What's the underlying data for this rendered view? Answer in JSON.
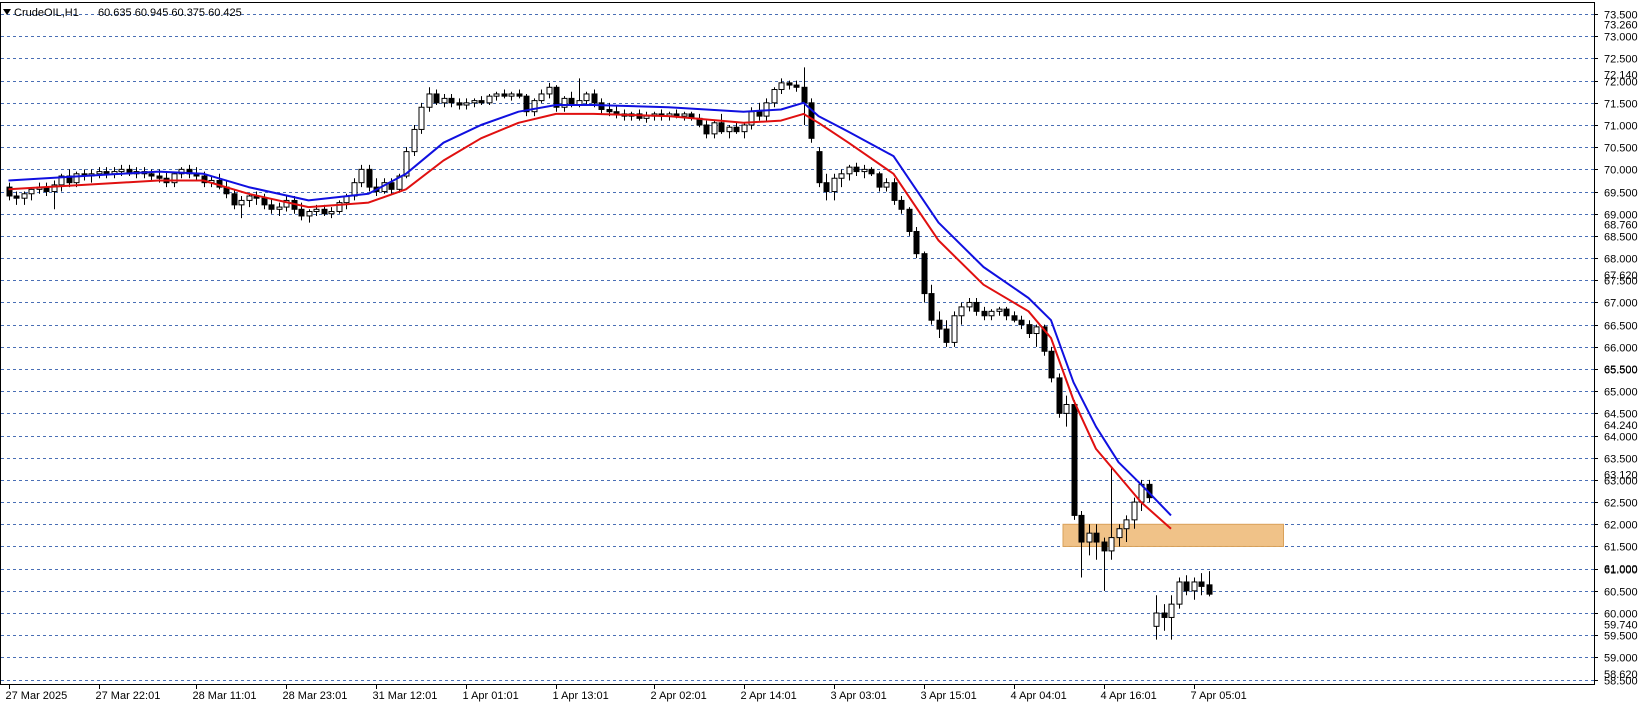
{
  "header": {
    "symbol": "CrudeOIL,H1",
    "ohlc_text": "60.635 60.945 60.375 60.425"
  },
  "colors": {
    "background": "#ffffff",
    "grid": "#4a6fb5",
    "axis": "#000000",
    "ma_fast": "#1010e0",
    "ma_slow": "#e01010",
    "zone": "#f0c288",
    "zone_border": "#d9a15a"
  },
  "chart_data": {
    "type": "candlestick",
    "y_ticks": [
      "73.500",
      "73.000",
      "72.500",
      "72.000",
      "71.500",
      "71.000",
      "70.500",
      "70.000",
      "69.500",
      "69.000",
      "68.500",
      "68.000",
      "67.500",
      "67.000",
      "66.500",
      "66.000",
      "65.500",
      "65.000",
      "64.500",
      "64.000",
      "63.500",
      "63.000",
      "62.500",
      "62.000",
      "61.500",
      "61.000",
      "60.500",
      "60.000",
      "59.500",
      "59.000",
      "58.500"
    ],
    "y_extra_labels": [
      "73.260",
      "72.140",
      "68.760",
      "67.620",
      "65.500",
      "64.240",
      "63.120",
      "61.000",
      "59.740",
      "58.620"
    ],
    "ylim": [
      58.4,
      73.75
    ],
    "x_ticks": [
      {
        "bar": 0,
        "label": "27 Mar 2025"
      },
      {
        "bar": 12,
        "label": "27 Mar 22:01"
      },
      {
        "bar": 25,
        "label": "28 Mar 11:01"
      },
      {
        "bar": 37,
        "label": "28 Mar 23:01"
      },
      {
        "bar": 49,
        "label": "31 Mar 12:01"
      },
      {
        "bar": 61,
        "label": "1 Apr 01:01"
      },
      {
        "bar": 73,
        "label": "1 Apr 13:01"
      },
      {
        "bar": 86,
        "label": "2 Apr 02:01"
      },
      {
        "bar": 98,
        "label": "2 Apr 14:01"
      },
      {
        "bar": 110,
        "label": "3 Apr 03:01"
      },
      {
        "bar": 122,
        "label": "3 Apr 15:01"
      },
      {
        "bar": 134,
        "label": "4 Apr 04:01"
      },
      {
        "bar": 146,
        "label": "4 Apr 16:01"
      },
      {
        "bar": 158,
        "label": "7 Apr 05:01"
      }
    ],
    "zone": {
      "from_bar": 141,
      "to_bar": 170,
      "low": 61.5,
      "high": 62.0
    },
    "candles": [
      [
        69.6,
        69.7,
        69.3,
        69.4
      ],
      [
        69.4,
        69.5,
        69.2,
        69.35
      ],
      [
        69.35,
        69.5,
        69.2,
        69.45
      ],
      [
        69.45,
        69.6,
        69.3,
        69.55
      ],
      [
        69.55,
        69.7,
        69.45,
        69.6
      ],
      [
        69.6,
        69.7,
        69.4,
        69.5
      ],
      [
        69.5,
        69.75,
        69.1,
        69.65
      ],
      [
        69.65,
        69.9,
        69.5,
        69.85
      ],
      [
        69.85,
        70.0,
        69.6,
        69.7
      ],
      [
        69.7,
        69.95,
        69.6,
        69.9
      ],
      [
        69.9,
        70.0,
        69.75,
        69.85
      ],
      [
        69.85,
        70.0,
        69.7,
        69.9
      ],
      [
        69.9,
        70.05,
        69.8,
        69.95
      ],
      [
        69.95,
        70.05,
        69.8,
        69.9
      ],
      [
        69.9,
        70.05,
        69.8,
        69.95
      ],
      [
        69.95,
        70.1,
        69.85,
        70.0
      ],
      [
        70.0,
        70.1,
        69.85,
        69.9
      ],
      [
        69.9,
        70.05,
        69.8,
        69.95
      ],
      [
        69.95,
        70.05,
        69.8,
        69.9
      ],
      [
        69.9,
        70.0,
        69.75,
        69.85
      ],
      [
        69.85,
        70.0,
        69.7,
        69.8
      ],
      [
        69.8,
        69.95,
        69.6,
        69.7
      ],
      [
        69.7,
        69.95,
        69.6,
        69.9
      ],
      [
        69.9,
        70.05,
        69.8,
        70.0
      ],
      [
        70.0,
        70.1,
        69.8,
        69.9
      ],
      [
        69.9,
        70.05,
        69.75,
        69.85
      ],
      [
        69.85,
        69.95,
        69.6,
        69.7
      ],
      [
        69.7,
        69.85,
        69.6,
        69.75
      ],
      [
        69.75,
        69.9,
        69.55,
        69.6
      ],
      [
        69.6,
        69.75,
        69.35,
        69.45
      ],
      [
        69.45,
        69.55,
        69.1,
        69.2
      ],
      [
        69.2,
        69.4,
        68.9,
        69.3
      ],
      [
        69.3,
        69.45,
        69.15,
        69.4
      ],
      [
        69.4,
        69.5,
        69.2,
        69.35
      ],
      [
        69.35,
        69.45,
        69.1,
        69.2
      ],
      [
        69.2,
        69.35,
        69.0,
        69.1
      ],
      [
        69.1,
        69.25,
        68.95,
        69.15
      ],
      [
        69.15,
        69.4,
        69.05,
        69.3
      ],
      [
        69.3,
        69.4,
        69.0,
        69.1
      ],
      [
        69.1,
        69.25,
        68.85,
        68.95
      ],
      [
        68.95,
        69.1,
        68.8,
        69.05
      ],
      [
        69.05,
        69.2,
        68.95,
        69.1
      ],
      [
        69.1,
        69.2,
        68.95,
        69.0
      ],
      [
        69.0,
        69.15,
        68.9,
        69.05
      ],
      [
        69.05,
        69.3,
        69.0,
        69.25
      ],
      [
        69.25,
        69.45,
        69.1,
        69.4
      ],
      [
        69.4,
        69.8,
        69.3,
        69.7
      ],
      [
        69.7,
        70.1,
        69.6,
        70.0
      ],
      [
        70.0,
        70.1,
        69.5,
        69.6
      ],
      [
        69.6,
        69.8,
        69.4,
        69.5
      ],
      [
        69.5,
        69.8,
        69.45,
        69.7
      ],
      [
        69.7,
        69.8,
        69.45,
        69.55
      ],
      [
        69.55,
        69.9,
        69.5,
        69.85
      ],
      [
        69.85,
        70.5,
        69.8,
        70.4
      ],
      [
        70.4,
        71.0,
        70.3,
        70.9
      ],
      [
        70.9,
        71.5,
        70.8,
        71.4
      ],
      [
        71.4,
        71.85,
        71.3,
        71.7
      ],
      [
        71.7,
        71.8,
        71.45,
        71.5
      ],
      [
        71.5,
        71.7,
        71.4,
        71.6
      ],
      [
        71.6,
        71.7,
        71.4,
        71.5
      ],
      [
        71.5,
        71.6,
        71.35,
        71.45
      ],
      [
        71.45,
        71.6,
        71.35,
        71.5
      ],
      [
        71.5,
        71.6,
        71.4,
        71.55
      ],
      [
        71.55,
        71.65,
        71.45,
        71.5
      ],
      [
        71.5,
        71.7,
        71.45,
        71.65
      ],
      [
        71.65,
        71.75,
        71.55,
        71.7
      ],
      [
        71.7,
        71.8,
        71.6,
        71.65
      ],
      [
        71.65,
        71.75,
        71.55,
        71.7
      ],
      [
        71.7,
        71.8,
        71.6,
        71.65
      ],
      [
        71.65,
        71.7,
        71.2,
        71.3
      ],
      [
        71.3,
        71.6,
        71.2,
        71.55
      ],
      [
        71.55,
        71.8,
        71.5,
        71.7
      ],
      [
        71.7,
        71.95,
        71.6,
        71.85
      ],
      [
        71.85,
        71.9,
        71.3,
        71.4
      ],
      [
        71.4,
        71.65,
        71.3,
        71.6
      ],
      [
        71.6,
        71.75,
        71.4,
        71.45
      ],
      [
        71.45,
        72.05,
        71.4,
        71.55
      ],
      [
        71.55,
        71.75,
        71.45,
        71.7
      ],
      [
        71.7,
        71.8,
        71.4,
        71.5
      ],
      [
        71.5,
        71.6,
        71.25,
        71.35
      ],
      [
        71.35,
        71.5,
        71.2,
        71.3
      ],
      [
        71.3,
        71.45,
        71.15,
        71.25
      ],
      [
        71.25,
        71.35,
        71.1,
        71.2
      ],
      [
        71.2,
        71.3,
        71.1,
        71.25
      ],
      [
        71.25,
        71.35,
        71.1,
        71.15
      ],
      [
        71.15,
        71.3,
        71.05,
        71.2
      ],
      [
        71.2,
        71.3,
        71.1,
        71.25
      ],
      [
        71.25,
        71.35,
        71.1,
        71.2
      ],
      [
        71.2,
        71.3,
        71.1,
        71.25
      ],
      [
        71.25,
        71.35,
        71.15,
        71.2
      ],
      [
        71.2,
        71.3,
        71.1,
        71.25
      ],
      [
        71.25,
        71.3,
        71.1,
        71.15
      ],
      [
        71.15,
        71.25,
        70.95,
        71.0
      ],
      [
        71.0,
        71.1,
        70.7,
        70.8
      ],
      [
        70.8,
        71.1,
        70.7,
        71.05
      ],
      [
        71.05,
        71.25,
        70.8,
        70.85
      ],
      [
        70.85,
        71.0,
        70.7,
        70.95
      ],
      [
        70.95,
        71.05,
        70.8,
        70.85
      ],
      [
        70.85,
        71.05,
        70.7,
        71.0
      ],
      [
        71.0,
        71.4,
        70.9,
        71.3
      ],
      [
        71.3,
        71.5,
        71.1,
        71.2
      ],
      [
        71.2,
        71.6,
        71.1,
        71.5
      ],
      [
        71.5,
        71.85,
        71.4,
        71.8
      ],
      [
        71.8,
        72.05,
        71.7,
        71.95
      ],
      [
        71.95,
        72.0,
        71.8,
        71.9
      ],
      [
        71.9,
        72.0,
        71.75,
        71.85
      ],
      [
        71.85,
        72.3,
        71.0,
        71.5
      ],
      [
        71.5,
        71.6,
        70.6,
        70.7
      ],
      [
        70.4,
        70.5,
        69.6,
        69.7
      ],
      [
        69.7,
        69.9,
        69.3,
        69.5
      ],
      [
        69.5,
        69.9,
        69.3,
        69.8
      ],
      [
        69.8,
        70.0,
        69.6,
        69.9
      ],
      [
        69.9,
        70.1,
        69.75,
        70.05
      ],
      [
        70.05,
        70.15,
        69.85,
        69.95
      ],
      [
        69.95,
        70.1,
        69.8,
        70.0
      ],
      [
        70.0,
        70.05,
        69.85,
        69.9
      ],
      [
        69.9,
        69.95,
        69.5,
        69.6
      ],
      [
        69.6,
        69.8,
        69.5,
        69.7
      ],
      [
        69.7,
        69.8,
        69.2,
        69.3
      ],
      [
        69.3,
        69.4,
        69.0,
        69.1
      ],
      [
        69.1,
        69.15,
        68.5,
        68.6
      ],
      [
        68.6,
        68.7,
        68.0,
        68.1
      ],
      [
        68.1,
        68.15,
        67.0,
        67.2
      ],
      [
        67.2,
        67.4,
        66.5,
        66.6
      ],
      [
        66.6,
        66.8,
        66.2,
        66.4
      ],
      [
        66.4,
        66.6,
        66.0,
        66.1
      ],
      [
        66.1,
        66.8,
        66.0,
        66.7
      ],
      [
        66.7,
        67.0,
        66.5,
        66.9
      ],
      [
        66.9,
        67.1,
        66.8,
        67.0
      ],
      [
        67.0,
        67.1,
        66.7,
        66.8
      ],
      [
        66.8,
        66.9,
        66.6,
        66.7
      ],
      [
        66.7,
        66.85,
        66.6,
        66.8
      ],
      [
        66.8,
        66.9,
        66.7,
        66.85
      ],
      [
        66.85,
        66.9,
        66.6,
        66.7
      ],
      [
        66.7,
        66.8,
        66.55,
        66.6
      ],
      [
        66.6,
        66.7,
        66.4,
        66.5
      ],
      [
        66.5,
        66.6,
        66.2,
        66.3
      ],
      [
        66.3,
        66.5,
        66.0,
        66.45
      ],
      [
        66.45,
        66.5,
        65.8,
        65.9
      ],
      [
        65.9,
        66.0,
        65.2,
        65.3
      ],
      [
        65.3,
        65.4,
        64.4,
        64.5
      ],
      [
        64.5,
        64.9,
        64.2,
        64.7
      ],
      [
        64.7,
        64.8,
        62.1,
        62.2
      ],
      [
        62.2,
        62.3,
        60.8,
        61.6
      ],
      [
        61.6,
        62.0,
        61.3,
        61.8
      ],
      [
        61.8,
        62.0,
        61.2,
        61.6
      ],
      [
        61.6,
        61.7,
        60.5,
        61.4
      ],
      [
        61.4,
        63.3,
        61.2,
        61.7
      ],
      [
        61.7,
        62.0,
        61.5,
        61.9
      ],
      [
        61.9,
        62.2,
        61.6,
        62.1
      ],
      [
        62.1,
        62.6,
        61.9,
        62.5
      ],
      [
        62.5,
        63.0,
        62.3,
        62.9
      ],
      [
        62.9,
        63.0,
        62.5,
        62.6
      ],
      [
        59.7,
        60.4,
        59.4,
        60.0
      ],
      [
        60.0,
        60.2,
        59.6,
        59.9
      ],
      [
        59.9,
        60.4,
        59.4,
        60.2
      ],
      [
        60.2,
        60.8,
        60.1,
        60.7
      ],
      [
        60.7,
        60.85,
        60.4,
        60.5
      ],
      [
        60.5,
        60.8,
        60.3,
        60.7
      ],
      [
        60.7,
        60.9,
        60.4,
        60.6
      ],
      [
        60.635,
        60.945,
        60.375,
        60.425
      ]
    ],
    "ma_fast": [
      [
        0,
        69.75
      ],
      [
        10,
        69.85
      ],
      [
        20,
        69.95
      ],
      [
        26,
        69.9
      ],
      [
        32,
        69.6
      ],
      [
        40,
        69.3
      ],
      [
        48,
        69.45
      ],
      [
        53,
        69.9
      ],
      [
        58,
        70.6
      ],
      [
        63,
        71.0
      ],
      [
        68,
        71.3
      ],
      [
        73,
        71.45
      ],
      [
        78,
        71.45
      ],
      [
        88,
        71.4
      ],
      [
        98,
        71.3
      ],
      [
        103,
        71.35
      ],
      [
        106,
        71.5
      ],
      [
        108,
        71.2
      ],
      [
        112,
        70.85
      ],
      [
        118,
        70.3
      ],
      [
        124,
        68.8
      ],
      [
        130,
        67.8
      ],
      [
        136,
        67.1
      ],
      [
        139,
        66.6
      ],
      [
        142,
        65.2
      ],
      [
        145,
        64.2
      ],
      [
        148,
        63.4
      ],
      [
        151,
        62.9
      ],
      [
        155,
        62.2
      ]
    ],
    "ma_slow": [
      [
        0,
        69.55
      ],
      [
        10,
        69.65
      ],
      [
        20,
        69.75
      ],
      [
        26,
        69.75
      ],
      [
        32,
        69.45
      ],
      [
        40,
        69.15
      ],
      [
        48,
        69.25
      ],
      [
        53,
        69.55
      ],
      [
        58,
        70.2
      ],
      [
        63,
        70.7
      ],
      [
        68,
        71.05
      ],
      [
        73,
        71.25
      ],
      [
        78,
        71.25
      ],
      [
        88,
        71.2
      ],
      [
        98,
        71.05
      ],
      [
        103,
        71.1
      ],
      [
        106,
        71.25
      ],
      [
        108,
        71.05
      ],
      [
        112,
        70.6
      ],
      [
        118,
        69.9
      ],
      [
        124,
        68.4
      ],
      [
        130,
        67.4
      ],
      [
        136,
        66.8
      ],
      [
        139,
        66.2
      ],
      [
        142,
        64.8
      ],
      [
        145,
        63.7
      ],
      [
        148,
        63.1
      ],
      [
        151,
        62.5
      ],
      [
        155,
        61.9
      ]
    ]
  }
}
